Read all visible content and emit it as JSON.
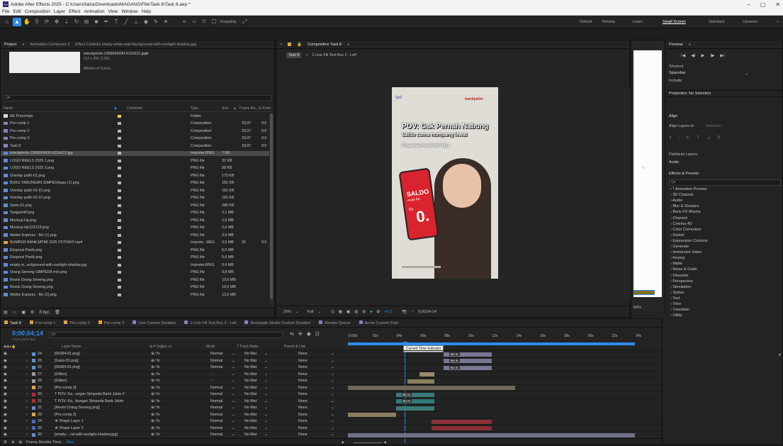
{
  "app": {
    "title": "Adobe After Effects 2025 - C:\\Users\\faiza\\Downloads\\MAGANG\\File\\Task 8\\Task 8.aep *",
    "logo_text": "Ae",
    "win_minimize": "–",
    "win_restore": "▢",
    "win_close": "✕"
  },
  "menu": [
    "File",
    "Edit",
    "Composition",
    "Layer",
    "Effect",
    "Animation",
    "View",
    "Window",
    "Help"
  ],
  "toolbar": {
    "snapping": "Snapping",
    "workspaces": [
      "Default",
      "Review",
      "Learn",
      "Small Screen",
      "Standard",
      "Libraries"
    ],
    "more": "»"
  },
  "project": {
    "tab_project": "Project",
    "tab_menu": "≡",
    "tab_composer": "Animation Composer 3",
    "tab_effect_controls": "Effect Controls empty-white-wall-background-with-sunlight-shadow.jpg",
    "preview_name": "istockphoto-1366693430-612x612.jpg▾",
    "preview_dims": "612 x 391 (1,00)",
    "preview_colors": "Millions of Colors",
    "search_placeholder": "Q▾",
    "columns": {
      "name": "Name",
      "comment": "Comment",
      "type": "Type",
      "size": "Size",
      "frame_rate": "Frame Ra...",
      "in_point": "In Point"
    },
    "bpc": "8 bpc",
    "rows": [
      {
        "name": "AE Precomps",
        "type": "Folder",
        "size": "",
        "fr": "",
        "ip": ""
      },
      {
        "name": "Pre-comp 1",
        "type": "Composition",
        "size": "",
        "fr": "29,97",
        "ip": "0;0"
      },
      {
        "name": "Pre-comp 2",
        "type": "Composition",
        "size": "",
        "fr": "29,97",
        "ip": "0;0"
      },
      {
        "name": "Pre-comp 3",
        "type": "Composition",
        "size": "",
        "fr": "29,97",
        "ip": "0;0"
      },
      {
        "name": "Task 8",
        "type": "Composition",
        "size": "",
        "fr": "29,97",
        "ip": "0;0"
      },
      {
        "name": "istockphoto-1366693430-612x612.jpg",
        "type": "ImporterJPEG",
        "size": "7 KB",
        "fr": "",
        "ip": ""
      },
      {
        "name": "LOGO REELS 2025 1.png",
        "type": "PNG file",
        "size": "32 KB",
        "fr": "",
        "ip": ""
      },
      {
        "name": "LOGO REELS 2025 2.png",
        "type": "PNG file",
        "size": "38 KB",
        "fr": "",
        "ip": ""
      },
      {
        "name": "Overlay putih-01.png",
        "type": "PNG file",
        "size": "175 KB",
        "fr": "",
        "ip": ""
      },
      {
        "name": "BUKU TABUNGAN SIMPEDAaaa (1).png",
        "type": "PNG file",
        "size": "181 KB",
        "fr": "",
        "ip": ""
      },
      {
        "name": "Overlay putih-01-01.png",
        "type": "PNG file",
        "size": "181 KB",
        "fr": "",
        "ip": ""
      },
      {
        "name": "Overlay putih-01-01.png",
        "type": "PNG file",
        "size": "181 KB",
        "fr": "",
        "ip": ""
      },
      {
        "name": "Garis-01.png",
        "type": "PNG file",
        "size": "285 KB",
        "fr": "",
        "ip": ""
      },
      {
        "name": "TanganHP.png",
        "type": "PNG file",
        "size": "2,1 MB",
        "fr": "",
        "ip": ""
      },
      {
        "name": "Mockup Hp.png",
        "type": "PNG file",
        "size": "2,6 MB",
        "fr": "",
        "ip": ""
      },
      {
        "name": "Mockup Hp123123.png",
        "type": "PNG file",
        "size": "2,6 MB",
        "fr": "",
        "ip": ""
      },
      {
        "name": "Adobe Express - file (1).png",
        "type": "PNG file",
        "size": "3,5 MB",
        "fr": "",
        "ip": ""
      },
      {
        "name": "BUMPER BANKJATIM 2025 POTRAIT.mp4",
        "type": "Importe...MEX",
        "size": "3,5 MB",
        "fr": "30",
        "ip": "0:0"
      },
      {
        "name": "Ekspresi Panik.png",
        "type": "PNG file",
        "size": "5,6 MB",
        "fr": "",
        "ip": ""
      },
      {
        "name": "Ekspresi Panik.png",
        "type": "PNG file",
        "size": "5,6 MB",
        "fr": "",
        "ip": ""
      },
      {
        "name": "empty-w...ackground-with-sunlight-shadow.jpg",
        "type": "ImporterJPEG",
        "size": "9,4 MB",
        "fr": "",
        "ip": ""
      },
      {
        "name": "Orang Seneng SIMPEDA-min.png",
        "type": "PNG file",
        "size": "9,8 MB",
        "fr": "",
        "ip": ""
      },
      {
        "name": "Revisi Orang Seneng.png",
        "type": "PNG file",
        "size": "10,0 MB",
        "fr": "",
        "ip": ""
      },
      {
        "name": "Revisi Orang Seneng.png",
        "type": "PNG file",
        "size": "10,0 MB",
        "fr": "",
        "ip": ""
      },
      {
        "name": "Adobe Express - file (2).png",
        "type": "PNG file",
        "size": "12,0 MB",
        "fr": "",
        "ip": ""
      }
    ]
  },
  "composition": {
    "tab": "Composition Task 8",
    "breadcrumb_task": "Task 8",
    "breadcrumb_arrow": "<",
    "breadcrumb_layer": "1-Line Fill Text Box 2 - Left",
    "frame": {
      "logo_left": "lpd",
      "logo_right": "bankjatim",
      "headline": "POV: Gak Pernah Nabung",
      "sub1": "Saldo cuma numpang lewat",
      "sub2": "Financial freedom? Bye",
      "phone_title": "SALDO",
      "phone_sub": "Anda Rp.",
      "phone_rp": "Rp.",
      "phone_zero": "0."
    },
    "zoom": "25%",
    "resolution": "Full",
    "exposure": "+0,0",
    "timecode": "0;00;04;14"
  },
  "right": {
    "preview_tab": "Preview",
    "preview_controls": [
      "I◀",
      "◀I",
      "▶",
      "I▶",
      "▶I"
    ],
    "shortcut_label": "Shortcut",
    "shortcut_value": "Spacebar",
    "include_label": "Include:",
    "properties": "Properties: No Selection",
    "align": "Align",
    "align_layers": "Align Layers to:",
    "align_target": "Selection",
    "distribute": "Distribute Layers:",
    "audio": "Audio",
    "effects_presets": "Effects & Presets",
    "search_placeholder": "Q▾",
    "zoom": "50%",
    "categories": [
      "* Animation Presets",
      "3D Channel",
      "Audio",
      "Blur & Sharpen",
      "Boris FX Mocha",
      "Channel",
      "Cinema 4D",
      "Color Correction",
      "Distort",
      "Expression Controls",
      "Generate",
      "Immersive Video",
      "Keying",
      "Matte",
      "Noise & Grain",
      "Obsolete",
      "Perspective",
      "Simulation",
      "Stylize",
      "Text",
      "Time",
      "Transition",
      "Utility"
    ]
  },
  "timeline": {
    "tabs": [
      "Task 8",
      "Pre-comp 1",
      "Pre-comp 2",
      "Pre-comp 3",
      "Line Custom Duration",
      "1-Line Fill Text Box 2 - Left",
      "Rectangle Stroke Custom Duration",
      "Render Queue",
      "Arrow Custom Path"
    ],
    "timecode": "0;00;04;14",
    "fps_info": "00134 (29,97 fps)",
    "search_placeholder": "Q▾",
    "ruler": [
      "0:00s",
      "02s",
      "04s",
      "06s",
      "08s",
      "10s",
      "12s",
      "14s",
      "16s",
      "18s",
      "20s",
      "22s",
      "24s"
    ],
    "tooltip": "Current Time Indicator",
    "col_layer_name": "Layer Name",
    "col_mode": "Mode",
    "col_track": "T  Track Matte",
    "col_parent": "Parent & Link",
    "footer": "Frame Render Time:",
    "footer_val": "0ms",
    "layers": [
      {
        "idx": "24",
        "name": "[09384-01.png]",
        "mode": "Normal",
        "track": "No Mat",
        "parent": "None"
      },
      {
        "idx": "25",
        "name": "[Garis-01.png]",
        "mode": "Normal",
        "track": "No Mat",
        "parent": "None"
      },
      {
        "idx": "26",
        "name": "[09384-01.png]",
        "mode": "Normal",
        "track": "No Mat",
        "parent": "None"
      },
      {
        "idx": "27",
        "name": "[Glitter]",
        "mode": "-",
        "track": "No Mat",
        "parent": "None"
      },
      {
        "idx": "28",
        "name": "[Glitter]",
        "mode": "-",
        "track": "No Mat",
        "parent": "None"
      },
      {
        "idx": "29",
        "name": "[Pre-comp 3]",
        "mode": "Normal",
        "track": "No Mat",
        "parent": "None"
      },
      {
        "idx": "30",
        "name": "T  POV: Ka...ungan Simpeda Bank Jatim 2",
        "mode": "Normal",
        "track": "No Mat",
        "parent": "None"
      },
      {
        "idx": "31",
        "name": "T  POV: Ka...bungan Simpeda Bank Jatim",
        "mode": "Normal",
        "track": "No Mat",
        "parent": "None"
      },
      {
        "idx": "32",
        "name": "[Revisi Orang Seneng.png]",
        "mode": "Normal",
        "track": "No Mat",
        "parent": "None"
      },
      {
        "idx": "33",
        "name": "[Pre-comp 2]",
        "mode": "Normal",
        "track": "No Mat",
        "parent": "None"
      },
      {
        "idx": "34",
        "name": "★ Shape Layer 1",
        "mode": "Normal",
        "track": "No Mat",
        "parent": "None"
      },
      {
        "idx": "35",
        "name": "★ Shape Layer 2",
        "mode": "Normal",
        "track": "No Mat",
        "parent": "None"
      },
      {
        "idx": "36",
        "name": "[empty-...nd-with-sunlight-shadow.jpg]",
        "mode": "Normal",
        "track": "No Mat",
        "parent": "None"
      }
    ],
    "keyframe_label": "Bo In"
  }
}
